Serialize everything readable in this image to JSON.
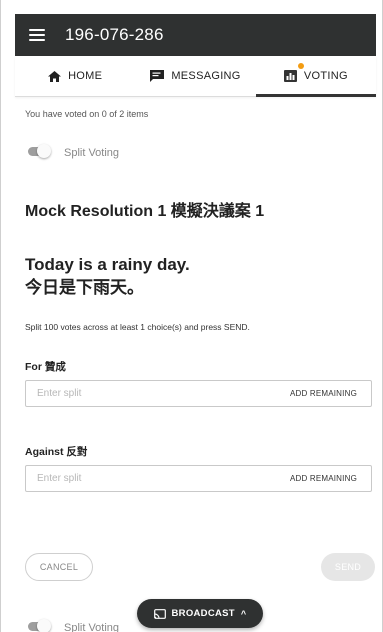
{
  "header": {
    "meeting_id": "196-076-286"
  },
  "tabs": [
    {
      "label": "HOME",
      "icon": "home-icon",
      "active": false
    },
    {
      "label": "MESSAGING",
      "icon": "chat-icon",
      "active": false
    },
    {
      "label": "VOTING",
      "icon": "bar-chart-icon",
      "active": true,
      "notification_color": "#f39c12"
    }
  ],
  "voting": {
    "status": "You have voted on 0 of 2 items",
    "split_toggle_label": "Split Voting",
    "resolution_title": "Mock Resolution 1 模擬決議案 1",
    "question_en": "Today is a rainy day.",
    "question_zh": "今日是下雨天。",
    "instructions": "Split 100 votes across at least 1 choice(s) and press SEND.",
    "choices": [
      {
        "label": "For 贊成",
        "value": "",
        "placeholder": "Enter split",
        "action": "ADD REMAINING"
      },
      {
        "label": "Against 反對",
        "value": "",
        "placeholder": "Enter split",
        "action": "ADD REMAINING"
      }
    ],
    "cancel_label": "CANCEL",
    "send_label": "SEND",
    "next_split_toggle_label": "Split Voting"
  },
  "broadcast": {
    "label": "BROADCAST",
    "chevron": "^"
  },
  "colors": {
    "header_bg": "#2f3131",
    "notification_dot": "#f39c12",
    "toggle_track": "#9e9e9e",
    "send_disabled_bg": "#e6e6e6"
  }
}
